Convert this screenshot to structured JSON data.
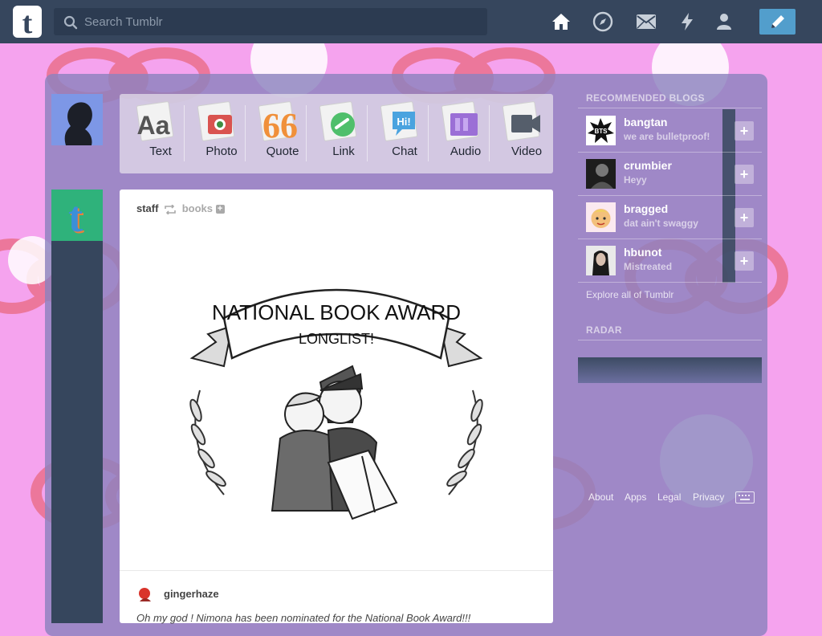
{
  "search": {
    "placeholder": "Search Tumblr"
  },
  "nav": {
    "icons": [
      "home-icon",
      "explore-icon",
      "inbox-icon",
      "activity-icon",
      "account-icon"
    ],
    "compose_icon": "pencil-icon"
  },
  "post_types": [
    {
      "label": "Text",
      "icon": "text-icon"
    },
    {
      "label": "Photo",
      "icon": "photo-icon"
    },
    {
      "label": "Quote",
      "icon": "quote-icon"
    },
    {
      "label": "Link",
      "icon": "link-icon"
    },
    {
      "label": "Chat",
      "icon": "chat-icon"
    },
    {
      "label": "Audio",
      "icon": "audio-icon"
    },
    {
      "label": "Video",
      "icon": "video-icon"
    }
  ],
  "post": {
    "author": "staff",
    "reblogged_from": "books",
    "image_text": {
      "banner": "NATIONAL BOOK AWARD",
      "subtitle": "LONGLIST!"
    },
    "reblogger": "gingerhaze",
    "caption": "Oh my god ! Nimona has been nominated for the National Book Award!!!"
  },
  "sidebar": {
    "recommended_heading": "RECOMMENDED BLOGS",
    "blogs": [
      {
        "name": "bangtan",
        "subtitle": "we are bulletproof!"
      },
      {
        "name": "crumbier",
        "subtitle": "Heyy"
      },
      {
        "name": "bragged",
        "subtitle": "dat ain't swaggy"
      },
      {
        "name": "hbunot",
        "subtitle": "Mistreated"
      }
    ],
    "explore_link": "Explore all of Tumblr",
    "radar_heading": "RADAR",
    "footer_links": [
      "About",
      "Apps",
      "Legal",
      "Privacy"
    ]
  },
  "colors": {
    "topbar": "#36465d",
    "accent": "#529ecc",
    "background": "#f5a3ee"
  }
}
